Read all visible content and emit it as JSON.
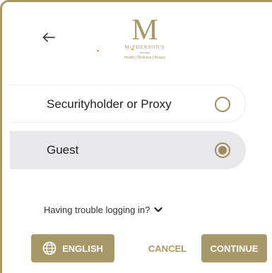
{
  "header": {
    "back_icon": "arrow-left-icon",
    "logo": {
      "letter": "M",
      "name": "McPHERSON'S",
      "est": "EST 1860",
      "tagline": "Health | Wellness | Beauty"
    }
  },
  "options": [
    {
      "label": "Securityholder or Proxy",
      "selected": false
    },
    {
      "label": "Guest",
      "selected": true
    }
  ],
  "help": {
    "trouble_text": "Having trouble logging in?",
    "icon": "chevron-down-icon"
  },
  "footer": {
    "language_label": "ENGLISH",
    "language_icon": "globe-icon",
    "cancel_label": "CANCEL",
    "continue_label": "CONTINUE"
  },
  "colors": {
    "accent": "#a89868",
    "selected_row_bg": "#e8e8ea",
    "radio": "#a08a5c"
  }
}
